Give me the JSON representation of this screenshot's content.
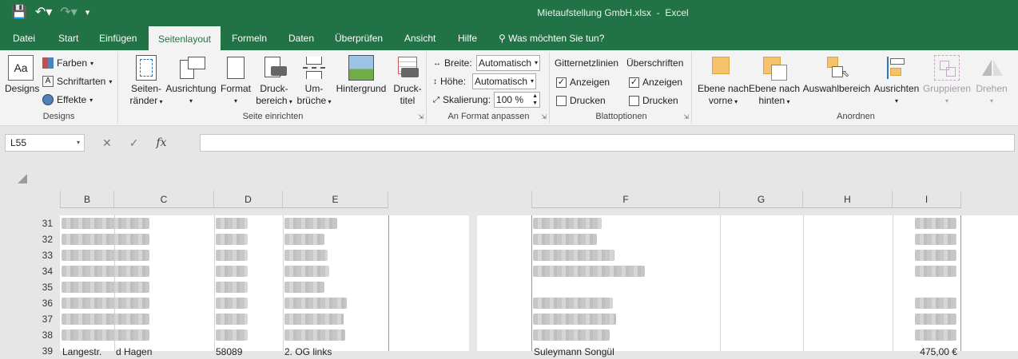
{
  "title": {
    "filename": "Mietaufstellung GmbH.xlsx",
    "app": "Excel"
  },
  "tabs": [
    "Datei",
    "Start",
    "Einfügen",
    "Seitenlayout",
    "Formeln",
    "Daten",
    "Überprüfen",
    "Ansicht",
    "Hilfe"
  ],
  "active_tab": "Seitenlayout",
  "tell_me": "Was möchten Sie tun?",
  "ribbon": {
    "designs": {
      "designs_btn": "Designs",
      "farben": "Farben",
      "schriftarten": "Schriftarten",
      "effekte": "Effekte",
      "group": "Designs"
    },
    "seite": {
      "raender_1": "Seiten-",
      "raender_2": "ränder",
      "ausrichtung": "Ausrichtung",
      "format": "Format",
      "druckbereich_1": "Druck-",
      "druckbereich_2": "bereich",
      "umbrueche_1": "Um-",
      "umbrueche_2": "brüche",
      "hintergrund": "Hintergrund",
      "drucktitel_1": "Druck-",
      "drucktitel_2": "titel",
      "group": "Seite einrichten"
    },
    "anpassen": {
      "breite_label": "Breite:",
      "breite_value": "Automatisch",
      "hoehe_label": "Höhe:",
      "hoehe_value": "Automatisch",
      "skalierung_label": "Skalierung:",
      "skalierung_value": "100 %",
      "group": "An Format anpassen"
    },
    "blatt": {
      "gitter": "Gitternetzlinien",
      "ueberschriften": "Überschriften",
      "anzeigen": "Anzeigen",
      "drucken": "Drucken",
      "group": "Blattoptionen"
    },
    "anordnen": {
      "vorne_1": "Ebene nach",
      "vorne_2": "vorne",
      "hinten_1": "Ebene nach",
      "hinten_2": "hinten",
      "auswahl": "Auswahlbereich",
      "ausrichten": "Ausrichten",
      "gruppieren": "Gruppieren",
      "drehen": "Drehen",
      "group": "Anordnen"
    }
  },
  "name_box": "L55",
  "columns_left": [
    "B",
    "C",
    "D",
    "E"
  ],
  "columns_right": [
    "F",
    "G",
    "H",
    "I"
  ],
  "rows": [
    "31",
    "32",
    "33",
    "34",
    "35",
    "36",
    "37",
    "38",
    "39"
  ],
  "last_row": {
    "b": "Langestr.",
    "c": "d Hagen",
    "d": "58089",
    "e": "2. OG links",
    "f": "Suleymann Songül",
    "i": "475,00 €"
  }
}
